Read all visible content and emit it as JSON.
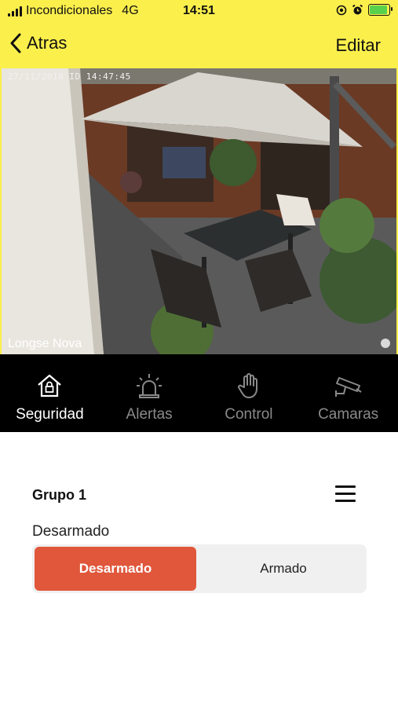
{
  "status_bar": {
    "carrier": "Incondicionales",
    "network": "4G",
    "time": "14:51",
    "battery_level": 0.9,
    "icons": [
      "signal-bars-icon",
      "location-lock-icon",
      "alarm-clock-icon",
      "battery-charging-icon"
    ]
  },
  "nav": {
    "back_label": "Atras",
    "edit_label": "Editar"
  },
  "camera": {
    "timestamp": "27/11/2018 ID 14:47:45",
    "name": "Longse Nova"
  },
  "tabs": [
    {
      "label": "Seguridad",
      "icon": "house-lock-icon",
      "active": true
    },
    {
      "label": "Alertas",
      "icon": "siren-icon",
      "active": false
    },
    {
      "label": "Control",
      "icon": "hand-icon",
      "active": false
    },
    {
      "label": "Camaras",
      "icon": "security-camera-icon",
      "active": false
    }
  ],
  "group": {
    "title": "Grupo 1",
    "state_label": "Desarmado",
    "options": [
      "Desarmado",
      "Armado"
    ],
    "selected": "Desarmado"
  },
  "colors": {
    "header_yellow": "#fbef4c",
    "tabbar_black": "#000000",
    "accent_orange": "#e0573b",
    "segment_bg": "#f0f0f0"
  }
}
